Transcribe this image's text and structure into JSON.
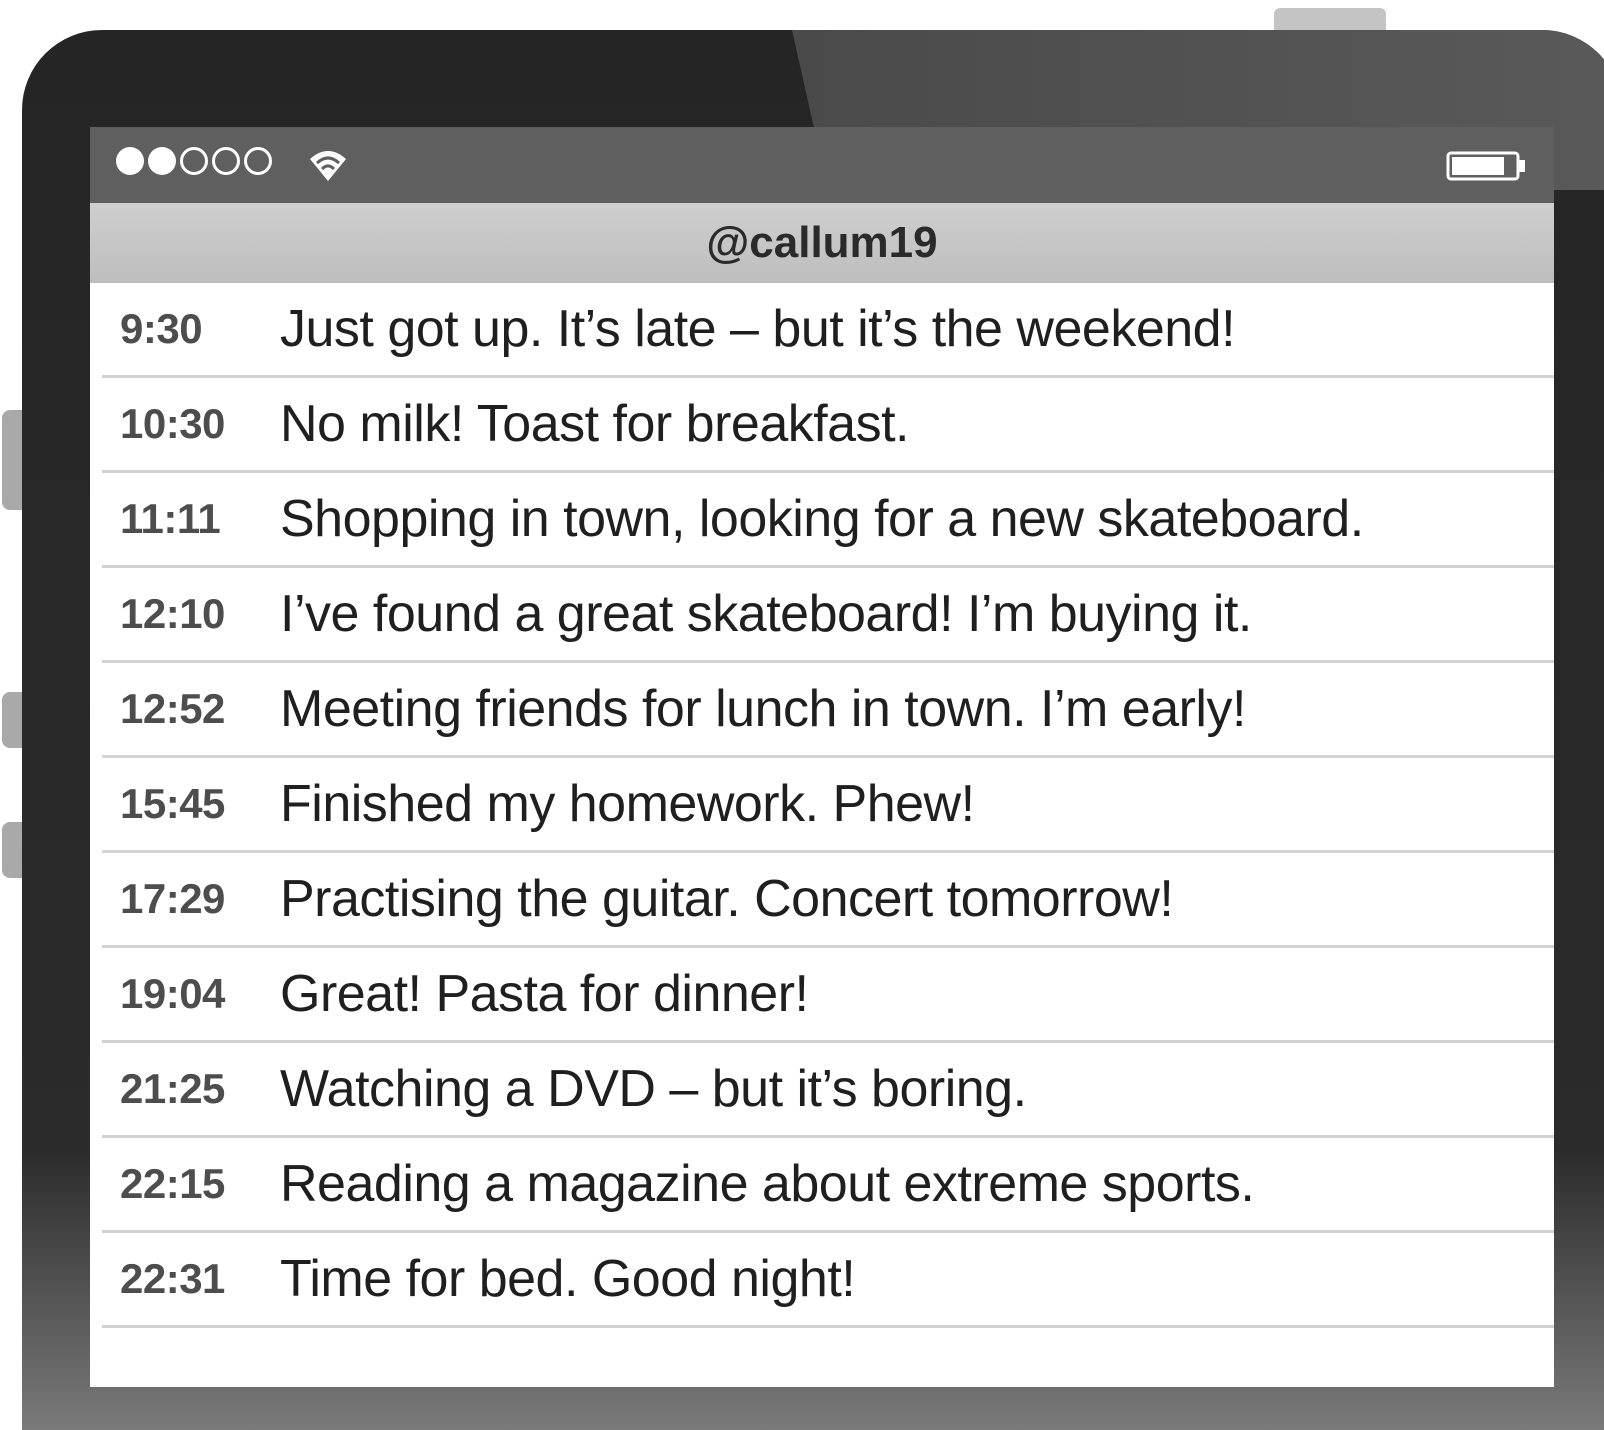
{
  "status_bar": {
    "signal_strength": {
      "filled": 2,
      "total": 5
    },
    "wifi_icon": "wifi-icon",
    "battery_icon": "battery-icon"
  },
  "header": {
    "title": "@callum19"
  },
  "feed": {
    "posts": [
      {
        "time": "9:30",
        "text": "Just got up. It’s late – but it’s the weekend!"
      },
      {
        "time": "10:30",
        "text": "No milk! Toast for breakfast."
      },
      {
        "time": "11:11",
        "text": "Shopping in town, looking for a new skateboard."
      },
      {
        "time": "12:10",
        "text": "I’ve found a great skateboard! I’m buying it."
      },
      {
        "time": "12:52",
        "text": "Meeting friends for lunch in town. I’m early!"
      },
      {
        "time": "15:45",
        "text": "Finished my homework. Phew!"
      },
      {
        "time": "17:29",
        "text": "Practising the guitar. Concert tomorrow!"
      },
      {
        "time": "19:04",
        "text": "Great! Pasta for dinner!"
      },
      {
        "time": "21:25",
        "text": "Watching a DVD – but it’s boring."
      },
      {
        "time": "22:15",
        "text": "Reading a magazine about extreme sports."
      },
      {
        "time": "22:31",
        "text": "Time for bed. Good night!"
      }
    ]
  }
}
